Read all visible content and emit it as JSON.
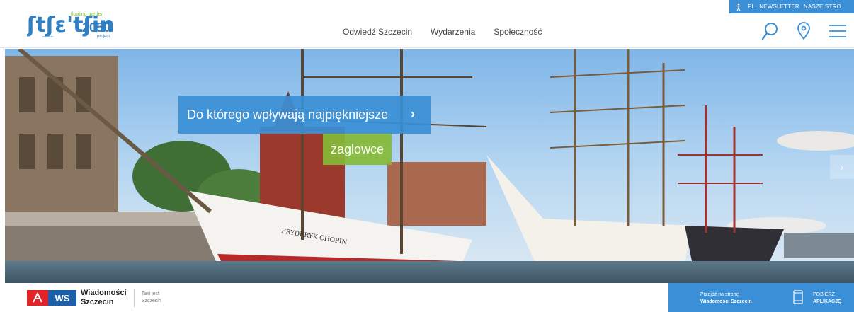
{
  "topbar": {
    "lang": "PL",
    "newsletter": "NEWSLETTER",
    "nasze": "NASZE STRO"
  },
  "logo": {
    "tagline": "floating garden",
    "year": "2050",
    "project": "project",
    "city": "szczecin"
  },
  "nav": {
    "items": [
      {
        "label": "Odwiedź Szczecin"
      },
      {
        "label": "Wydarzenia"
      },
      {
        "label": "Społeczność"
      }
    ]
  },
  "hero": {
    "caption_line1": "Do którego wpływają najpiękniejsze",
    "caption_line2": "żaglowce",
    "arrow": "›",
    "next": "›",
    "ship_name": "FRYDERYK CHOPIN"
  },
  "footer": {
    "ws_abbr": "WS",
    "ws_title_1": "Wiadomości",
    "ws_title_2": "Szczecin",
    "ws_tag_1": "Taki jest",
    "ws_tag_2": "Szczecin",
    "promo_line1": "Przejdź na stronę",
    "promo_line2": "Wiadomości Szczecin",
    "app_line1": "POBIERZ",
    "app_line2": "APLIKACJĘ"
  },
  "colors": {
    "accent_blue": "#3a8fd6",
    "accent_green": "#84ba36",
    "ws_red": "#e2232a",
    "ws_blue": "#1d5fa8"
  }
}
